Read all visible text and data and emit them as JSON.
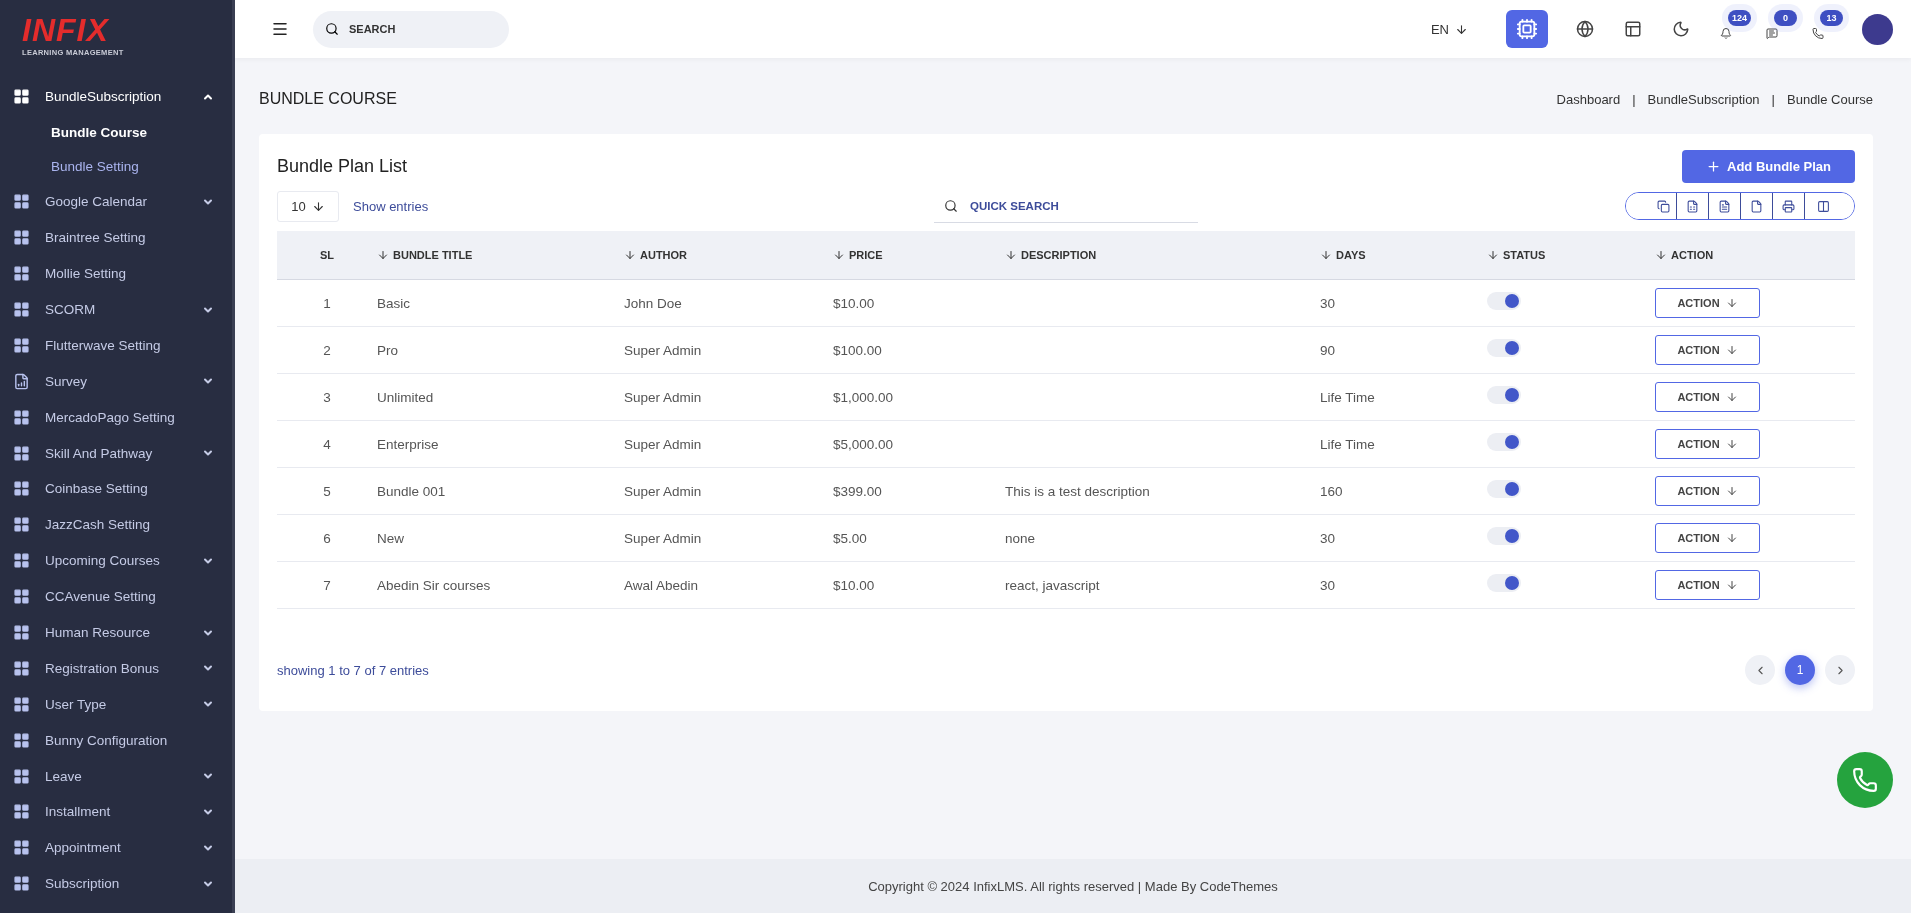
{
  "logo": {
    "brand": "INFIX",
    "tagline": "LEARNING MANAGEMENT"
  },
  "sidebar": {
    "items": [
      {
        "label": "BundleSubscription",
        "kind": "grid",
        "expanded": true,
        "children": [
          {
            "label": "Bundle Course",
            "selected": true
          },
          {
            "label": "Bundle Setting",
            "selected": false
          }
        ]
      },
      {
        "label": "Google Calendar",
        "kind": "grid",
        "expanded": false
      },
      {
        "label": "Braintree Setting",
        "kind": "grid"
      },
      {
        "label": "Mollie Setting",
        "kind": "grid"
      },
      {
        "label": "SCORM",
        "kind": "grid",
        "expanded": false
      },
      {
        "label": "Flutterwave Setting",
        "kind": "grid"
      },
      {
        "label": "Survey",
        "kind": "list",
        "expanded": false
      },
      {
        "label": "MercadoPago Setting",
        "kind": "grid"
      },
      {
        "label": "Skill And Pathway",
        "kind": "grid",
        "expanded": false
      },
      {
        "label": "Coinbase Setting",
        "kind": "grid"
      },
      {
        "label": "JazzCash Setting",
        "kind": "grid"
      },
      {
        "label": "Upcoming Courses",
        "kind": "grid",
        "expanded": false
      },
      {
        "label": "CCAvenue Setting",
        "kind": "grid"
      },
      {
        "label": "Human Resource",
        "kind": "grid",
        "expanded": false
      },
      {
        "label": "Registration Bonus",
        "kind": "grid",
        "expanded": false
      },
      {
        "label": "User Type",
        "kind": "grid",
        "expanded": false
      },
      {
        "label": "Bunny Configuration",
        "kind": "grid"
      },
      {
        "label": "Leave",
        "kind": "grid",
        "expanded": false
      },
      {
        "label": "Installment",
        "kind": "grid",
        "expanded": false
      },
      {
        "label": "Appointment",
        "kind": "grid",
        "expanded": false
      },
      {
        "label": "Subscription",
        "kind": "grid",
        "expanded": false
      }
    ]
  },
  "topbar": {
    "search": {
      "placeholder": "SEARCH"
    },
    "language": "EN",
    "notifications": [
      {
        "kind": "bell",
        "count": "124"
      },
      {
        "kind": "chat",
        "count": "0"
      },
      {
        "kind": "whatsapp",
        "count": "13"
      }
    ]
  },
  "page": {
    "title": "BUNDLE COURSE",
    "breadcrumbs": [
      {
        "label": "Dashboard"
      },
      {
        "separator": "|",
        "label": "BundleSubscription"
      },
      {
        "separator": "|",
        "label": "Bundle Course"
      }
    ]
  },
  "card": {
    "title": "Bundle Plan List",
    "add_button": "Add Bundle Plan",
    "page_size": "10",
    "page_size_label": "Show entries",
    "search": {
      "placeholder": "QUICK SEARCH"
    },
    "export_buttons": [
      {
        "kind": "copy"
      },
      {
        "kind": "excel"
      },
      {
        "kind": "csv"
      },
      {
        "kind": "pdf"
      },
      {
        "kind": "print"
      },
      {
        "kind": "columns"
      }
    ]
  },
  "table": {
    "columns": [
      {
        "label": "SL",
        "sortable": false
      },
      {
        "label": "BUNDLE TITLE",
        "sortable": true
      },
      {
        "label": "AUTHOR",
        "sortable": true
      },
      {
        "label": "PRICE",
        "sortable": true
      },
      {
        "label": "DESCRIPTION",
        "sortable": true
      },
      {
        "label": "DAYS",
        "sortable": true
      },
      {
        "label": "STATUS",
        "sortable": true
      },
      {
        "label": "ACTION",
        "sortable": true
      }
    ],
    "rows": [
      {
        "sl": "1",
        "title": "Basic",
        "author": "John Doe",
        "price": "$10.00",
        "days": "30",
        "status_on": true,
        "action": "ACTION"
      },
      {
        "sl": "2",
        "title": "Pro",
        "author": "Super Admin",
        "price": "$100.00",
        "days": "90",
        "status_on": true,
        "action": "ACTION"
      },
      {
        "sl": "3",
        "title": "Unlimited",
        "author": "Super Admin",
        "price": "$1,000.00",
        "days": "Life Time",
        "status_on": true,
        "action": "ACTION"
      },
      {
        "sl": "4",
        "title": "Enterprise",
        "author": "Super Admin",
        "price": "$5,000.00",
        "days": "Life Time",
        "status_on": true,
        "action": "ACTION"
      },
      {
        "sl": "5",
        "title": "Bundle 001",
        "author": "Super Admin",
        "price": "$399.00",
        "description": "This is a test description",
        "days": "160",
        "status_on": true,
        "action": "ACTION"
      },
      {
        "sl": "6",
        "title": "New",
        "author": "Super Admin",
        "price": "$5.00",
        "description": "none",
        "days": "30",
        "status_on": true,
        "action": "ACTION"
      },
      {
        "sl": "7",
        "title": "Abedin Sir courses",
        "author": "Awal Abedin",
        "price": "$10.00",
        "description": "react, javascript",
        "days": "30",
        "status_on": true,
        "action": "ACTION"
      }
    ]
  },
  "pagination": {
    "summary": "showing 1 to 7 of 7 entries",
    "pages": [
      {
        "label": "1",
        "selected": true
      }
    ]
  },
  "footer": "Copyright © 2024 InfixLMS. All rights reserved | Made By CodeThemes"
}
